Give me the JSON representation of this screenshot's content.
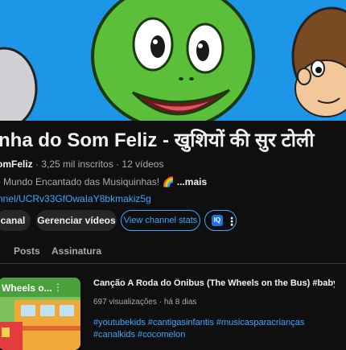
{
  "channel": {
    "title": "nha do Som Feliz - खुशियों की सुर टोली",
    "handle": "omFeliz",
    "subscribers": "3,25 mil inscritos",
    "videos": "12 vídeos",
    "description": "o Mundo Encantado das Musiquinhas! 🌈",
    "more_label": "...mais",
    "link": "nnel/UCRv33GfOwaIaY8bkmakiz5g"
  },
  "actions": {
    "canal_label": "canal",
    "manage_label": "Gerenciar vídeos",
    "stats_label": "View channel stats",
    "more_badge": "IQ",
    "more_dots": "⋮"
  },
  "tabs": [
    {
      "label": "Posts"
    },
    {
      "label": "Assinatura"
    }
  ],
  "video": {
    "thumb_title": "Wheels o...",
    "title": "Canção A Roda do Ônibus (The Wheels on the Bus) #babyson…",
    "views": "697 visualizações",
    "age": "há 8 dias",
    "tags_line1": "#youtubekids #cantigasinfantis #musicasparacrianças",
    "tags_line2": "#canalkids #cocomelon"
  },
  "colors": {
    "banner_sky": "#1e96e8",
    "link_blue": "#3ea6ff",
    "turtle_green": "#5bbf3a",
    "background": "#0f0f0f"
  }
}
